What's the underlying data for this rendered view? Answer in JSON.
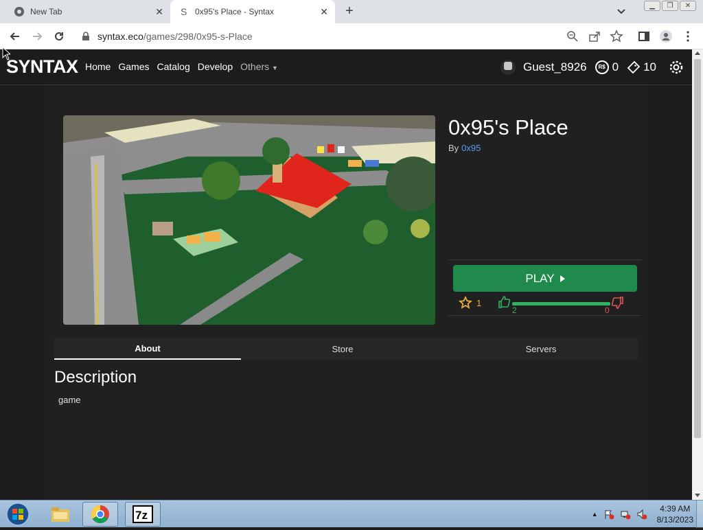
{
  "browser": {
    "tabs": [
      {
        "title": "New Tab",
        "active": false,
        "icon": "chrome-icon"
      },
      {
        "title": "0x95's Place - Syntax",
        "active": true,
        "icon": "syntax-s-icon"
      }
    ],
    "url_domain": "syntax.eco",
    "url_path": "/games/298/0x95-s-Place"
  },
  "site": {
    "logo": "SYNTAX",
    "nav": {
      "home": "Home",
      "games": "Games",
      "catalog": "Catalog",
      "develop": "Develop",
      "others": "Others"
    },
    "user": {
      "name": "Guest_8926",
      "robux": "0",
      "tickets": "10",
      "robux_symbol": "R$"
    }
  },
  "game": {
    "title": "0x95's Place",
    "by_label": "By",
    "creator": "0x95",
    "play_label": "PLAY",
    "favorites": "1",
    "upvotes": "2",
    "downvotes": "0",
    "upvote_fraction": 1.0,
    "colors": {
      "play": "#1f8a4c",
      "favorite": "#e9b03c",
      "upvote": "#2fb360",
      "downvote": "#e05757",
      "creator_link": "#5b9cf5"
    }
  },
  "tabs": {
    "about": "About",
    "store": "Store",
    "servers": "Servers",
    "active": "about"
  },
  "description": {
    "heading": "Description",
    "text": "game"
  },
  "taskbar": {
    "apps": [
      "windows-explorer",
      "google-chrome",
      "7-zip"
    ],
    "time": "4:39 AM",
    "date": "8/13/2023"
  }
}
